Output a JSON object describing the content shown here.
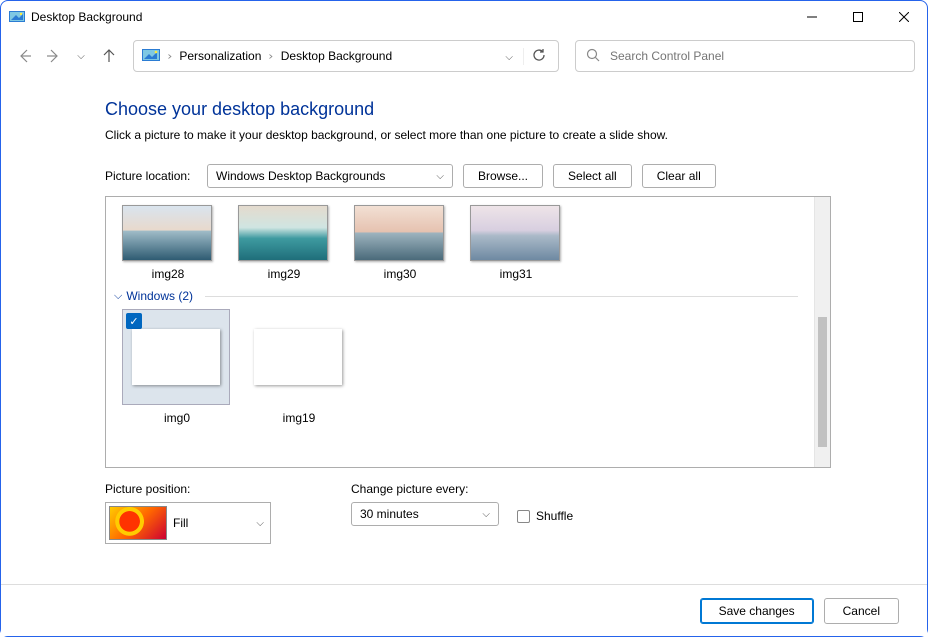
{
  "window": {
    "title": "Desktop Background"
  },
  "breadcrumb": {
    "item1": "Personalization",
    "item2": "Desktop Background"
  },
  "search": {
    "placeholder": "Search Control Panel"
  },
  "main": {
    "heading": "Choose your desktop background",
    "subheading": "Click a picture to make it your desktop background, or select more than one picture to create a slide show.",
    "picture_location_label": "Picture location:",
    "picture_location_value": "Windows Desktop Backgrounds",
    "browse_label": "Browse...",
    "select_all_label": "Select all",
    "clear_all_label": "Clear all"
  },
  "grid": {
    "row1": {
      "t0": "img28",
      "t1": "img29",
      "t2": "img30",
      "t3": "img31"
    },
    "group_label": "Windows (2)",
    "row2": {
      "t0": "img0",
      "t1": "img19"
    }
  },
  "position": {
    "label": "Picture position:",
    "value": "Fill"
  },
  "interval": {
    "label": "Change picture every:",
    "value": "30 minutes",
    "shuffle_label": "Shuffle"
  },
  "footer": {
    "save": "Save changes",
    "cancel": "Cancel"
  }
}
